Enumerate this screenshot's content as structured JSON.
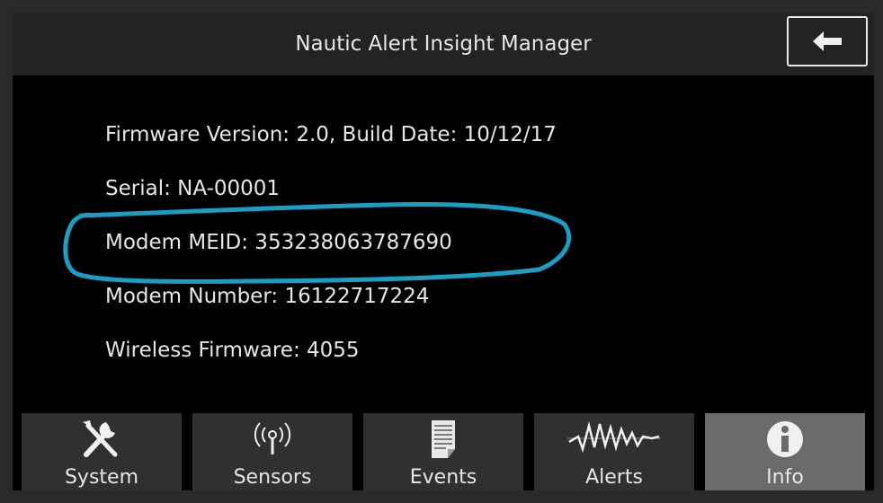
{
  "header": {
    "title": "Nautic Alert Insight Manager",
    "back_icon": "arrow-left-icon"
  },
  "info": {
    "firmware": "Firmware Version: 2.0, Build Date: 10/12/17",
    "serial": "Serial: NA-00001",
    "meid": "Modem MEID: 353238063787690",
    "number": "Modem Number: 16122717224",
    "wireless": "Wireless Firmware: 4055"
  },
  "tabs": [
    {
      "label": "System",
      "icon": "tools-icon"
    },
    {
      "label": "Sensors",
      "icon": "antenna-icon"
    },
    {
      "label": "Events",
      "icon": "document-icon"
    },
    {
      "label": "Alerts",
      "icon": "waveform-icon"
    },
    {
      "label": "Info",
      "icon": "info-icon"
    }
  ],
  "active_tab": "Info",
  "colors": {
    "highlight": "#1a9ec4",
    "active_tab": "#6b6b6b",
    "tab": "#303030"
  }
}
